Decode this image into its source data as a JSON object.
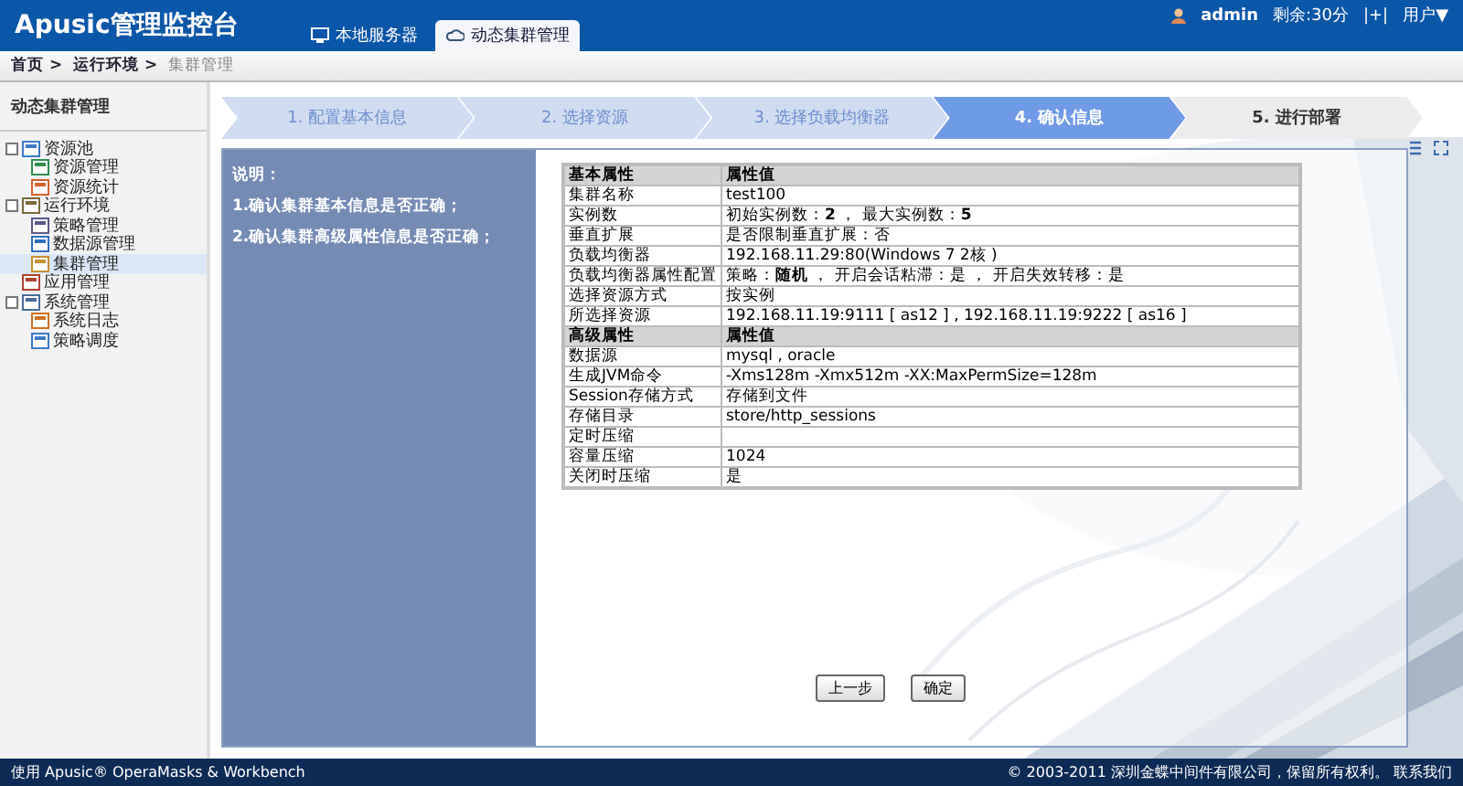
{
  "header": {
    "logo": "Apusic管理监控台",
    "tabs": [
      {
        "label": "本地服务器",
        "selected": false
      },
      {
        "label": "动态集群管理",
        "selected": true
      }
    ],
    "user": "admin",
    "remaining": "剩余:30分",
    "plus": "|+|",
    "user_menu": "用户▼"
  },
  "breadcrumb": [
    "首页 >",
    "运行环境 >",
    "集群管理"
  ],
  "sidebar": {
    "title": "动态集群管理",
    "items": [
      {
        "label": "资源池",
        "expanded": true,
        "selected": false,
        "children": [
          {
            "label": "资源管理",
            "selected": false
          },
          {
            "label": "资源统计",
            "selected": false
          }
        ]
      },
      {
        "label": "运行环境",
        "expanded": true,
        "selected": false,
        "children": [
          {
            "label": "策略管理",
            "selected": false
          },
          {
            "label": "数据源管理",
            "selected": false
          },
          {
            "label": "集群管理",
            "selected": true
          }
        ]
      },
      {
        "label": "应用管理",
        "expanded": false,
        "selected": false
      },
      {
        "label": "系统管理",
        "expanded": true,
        "selected": false,
        "children": [
          {
            "label": "系统日志",
            "selected": false
          },
          {
            "label": "策略调度",
            "selected": false
          }
        ]
      }
    ]
  },
  "steps": [
    {
      "label": "1. 配置基本信息",
      "selected": false,
      "completed": true
    },
    {
      "label": "2. 选择资源",
      "selected": false,
      "completed": true
    },
    {
      "label": "3. 选择负载均衡器",
      "selected": false,
      "completed": true
    },
    {
      "label": "4. 确认信息",
      "selected": true,
      "completed": false
    },
    {
      "label": "5. 进行部署",
      "selected": false,
      "completed": false
    }
  ],
  "notes": [
    "说明：",
    "1.确认集群基本信息是否正确；",
    "2.确认集群高级属性信息是否正确；"
  ],
  "table": [
    {
      "kind": "header",
      "name": "基本属性",
      "value": "属性值"
    },
    {
      "kind": "row",
      "name": "集群名称",
      "value": "test100"
    },
    {
      "kind": "row",
      "name": "实例数",
      "value": "初始实例数：**2**  ，  最大实例数：**5**"
    },
    {
      "kind": "row",
      "name": "垂直扩展",
      "value": "是否限制垂直扩展：否"
    },
    {
      "kind": "row",
      "name": "负载均衡器",
      "value": "192.168.11.29:80(Windows 7 2核 )"
    },
    {
      "kind": "row",
      "name": "负载均衡器属性配置",
      "value": "策略：**随机**  ，   开启会话粘滞：是   ，    开启失效转移：是"
    },
    {
      "kind": "row",
      "name": "选择资源方式",
      "value": "按实例"
    },
    {
      "kind": "row",
      "name": "所选择资源",
      "value": "192.168.11.19:9111 [ as12 ] , 192.168.11.19:9222 [ as16 ]"
    },
    {
      "kind": "header",
      "name": "高级属性",
      "value": "属性值"
    },
    {
      "kind": "row",
      "name": "数据源",
      "value": "mysql , oracle"
    },
    {
      "kind": "row",
      "name": "生成JVM命令",
      "value": "-Xms128m -Xmx512m -XX:MaxPermSize=128m"
    },
    {
      "kind": "row",
      "name": "Session存储方式",
      "value": "存储到文件"
    },
    {
      "kind": "row",
      "name": "存储目录",
      "value": "store/http_sessions"
    },
    {
      "kind": "row",
      "name": "定时压缩"
    },
    {
      "kind": "row",
      "name": "容量压缩",
      "value": "1024"
    },
    {
      "kind": "row",
      "name": "关闭时压缩",
      "value": "是"
    }
  ],
  "buttons": [
    "上一步",
    "确定"
  ],
  "footer": {
    "left": "使用 Apusic® OperaMasks & Workbench",
    "right": "© 2003-2011 深圳金蝶中间件有限公司，保留所有权利。 联系我们"
  }
}
